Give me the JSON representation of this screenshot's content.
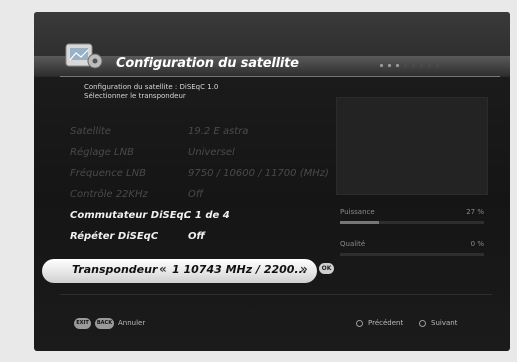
{
  "header": {
    "title": "Configuration du satellite"
  },
  "subtitle": {
    "line1": "Configuration du satellite : DiSEqC 1.0",
    "line2": "Sélectionner le transpondeur"
  },
  "rows": [
    {
      "label": "Satellite",
      "value": "19.2 E astra",
      "state": "disabled"
    },
    {
      "label": "Réglage LNB",
      "value": "Universel",
      "state": "disabled"
    },
    {
      "label": "Fréquence LNB",
      "value": "9750 / 10600 / 11700 (MHz)",
      "state": "disabled"
    },
    {
      "label": "Contrôle 22KHz",
      "value": "Off",
      "state": "disabled"
    },
    {
      "label": "Commutateur DiSEqC",
      "value": "... 1 de 4",
      "state": "active"
    },
    {
      "label": "Répéter DiSEqC",
      "value": "Off",
      "state": "active"
    }
  ],
  "selected_row": {
    "label": "Transpondeur",
    "value": "1 10743 MHz / 2200...",
    "prev_glyph": "«",
    "next_glyph": "»",
    "ok_label": "OK"
  },
  "signal": {
    "power_label": "Puissance",
    "power_value": "27 %",
    "power_level": 0.27,
    "quality_label": "Qualité",
    "quality_value": "0 %",
    "quality_level": 0
  },
  "footer": {
    "exit_label": "EXIT",
    "back_label": "BACK",
    "cancel_text": "Annuler",
    "previous_text": "Précédent",
    "next_text": "Suivant"
  },
  "colors": {
    "background": "#1a1a1a",
    "highlight": "#e8e8e8",
    "text_active": "#f0f0f0",
    "text_disabled": "#4a4a4a"
  }
}
